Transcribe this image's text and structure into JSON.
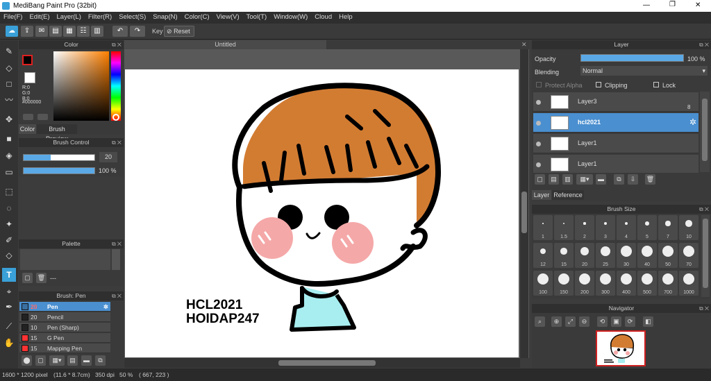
{
  "window": {
    "title": "MediBang Paint Pro (32bit)",
    "min": "—",
    "max": "❐",
    "close": "✕"
  },
  "menu": [
    "File(F)",
    "Edit(E)",
    "Layer(L)",
    "Filter(R)",
    "Select(S)",
    "Snap(N)",
    "Color(C)",
    "View(V)",
    "Tool(T)",
    "Window(W)",
    "Cloud",
    "Help"
  ],
  "toolbar": {
    "key_label": "Key",
    "reset_label": "Reset"
  },
  "color_panel": {
    "title": "Color",
    "r": "R:0",
    "g": "G:0",
    "b": "B:0",
    "hex": "#000000",
    "tab_color": "Color",
    "tab_preview": "Brush Preview"
  },
  "brush_control": {
    "title": "Brush Control",
    "size": "20",
    "opacity": "100 %",
    "opacity_level": 1.0,
    "size_level": 0.38
  },
  "palette": {
    "title": "Palette",
    "dash": "---"
  },
  "brush_list": {
    "title": "Brush: Pen",
    "items": [
      {
        "size": "20",
        "name": "Pen",
        "color": "#ff3333",
        "selected": true
      },
      {
        "size": "20",
        "name": "Pencil",
        "color": "#222222",
        "selected": false
      },
      {
        "size": "10",
        "name": "Pen (Sharp)",
        "color": "#222222",
        "selected": false
      },
      {
        "size": "15",
        "name": "G Pen",
        "color": "#ff3333",
        "selected": false
      },
      {
        "size": "15",
        "name": "Mapping Pen",
        "color": "#ff3333",
        "selected": false
      }
    ]
  },
  "document": {
    "tab": "Untitled",
    "text1": "HCL2021",
    "text2": "HOIDAP247"
  },
  "layer_panel": {
    "title": "Layer",
    "opacity_label": "Opacity",
    "opacity_value": "100 %",
    "opacity_level": 1.0,
    "blending_label": "Blending",
    "blending_value": "Normal",
    "protect_alpha": "Protect Alpha",
    "clipping": "Clipping",
    "lock": "Lock",
    "num": "8",
    "layers": [
      {
        "name": "Layer3",
        "selected": false
      },
      {
        "name": "hcl2021",
        "selected": true
      },
      {
        "name": "Layer1",
        "selected": false
      },
      {
        "name": "Layer1",
        "selected": false
      }
    ],
    "tab_layer": "Layer",
    "tab_reference": "Reference"
  },
  "brush_size": {
    "title": "Brush Size",
    "sizes": [
      "1",
      "1.5",
      "2",
      "3",
      "4",
      "5",
      "7",
      "10",
      "12",
      "15",
      "20",
      "25",
      "30",
      "40",
      "50",
      "70",
      "100",
      "150",
      "200",
      "300",
      "400",
      "500",
      "700",
      "1000"
    ]
  },
  "navigator": {
    "title": "Navigator"
  },
  "status": {
    "dims": "1600 * 1200 pixel",
    "cm": "(11.6 * 8.7cm)",
    "dpi": "350 dpi",
    "zoom": "50 %",
    "coords": "( 667, 223 )"
  }
}
